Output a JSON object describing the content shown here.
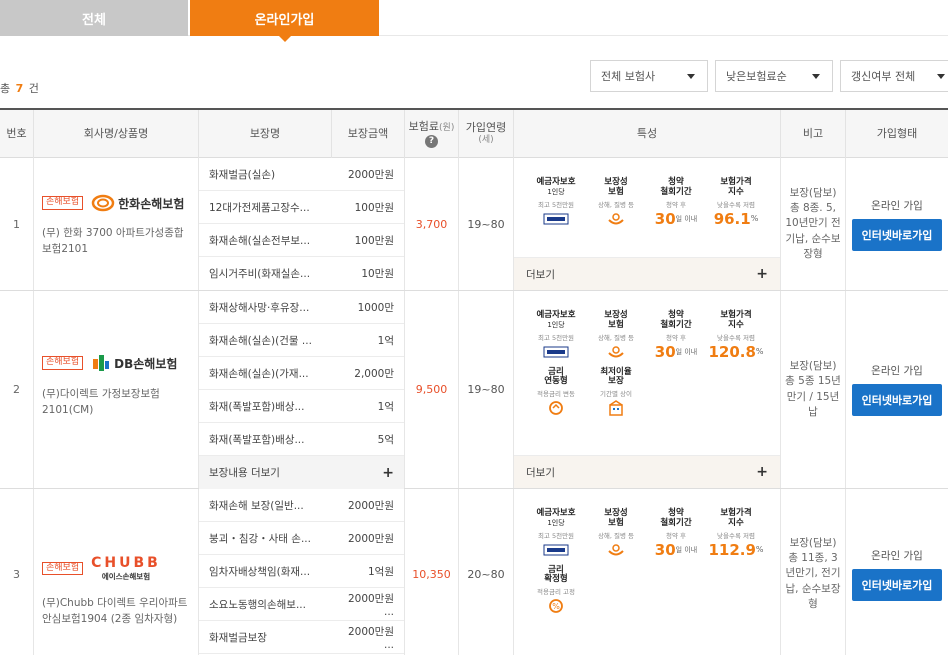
{
  "tabs": {
    "all": "전체",
    "online": "온라인가입"
  },
  "count": {
    "prefix": "총",
    "num": "7",
    "suffix": "건"
  },
  "filters": {
    "insurer": "전체 보험사",
    "sort": "낮은보험료순",
    "renew": "갱신여부 전체"
  },
  "header": {
    "no": "번호",
    "company": "회사명/상품명",
    "coverage": "보장명",
    "amount": "보장금액",
    "premium": "보험료",
    "premium_unit": "(원)",
    "age": "가입연령",
    "age_unit": "(세)",
    "features": "특성",
    "note": "비고",
    "type": "가입형태",
    "help": "?"
  },
  "feature_labels": {
    "deposit_t1": "예금자보호",
    "deposit_t2": "1인당",
    "deposit_s": "최고 5천만원",
    "guarantee_t1": "보장성",
    "guarantee_t2": "보험",
    "guarantee_s": "상해, 질병 등",
    "withdraw_t1": "청약",
    "withdraw_t2": "철회기간",
    "withdraw_s": "청약 후",
    "withdraw_days": "30",
    "withdraw_unit": "일 이내",
    "price_t1": "보험가격",
    "price_t2": "지수",
    "price_s": "낮을수록 저렴",
    "pct": "%",
    "rate_var_t1": "금리",
    "rate_var_t2": "연동형",
    "rate_var_s": "적용금리 변동",
    "min_rate_t1": "최저이율",
    "min_rate_t2": "보장",
    "min_rate_s": "기간별 상이",
    "rate_fix_t1": "금리",
    "rate_fix_t2": "확정형",
    "rate_fix_s": "적용금리 고정",
    "more": "더보기"
  },
  "colors": {
    "accent": "#f07d12",
    "premium": "#e8502a",
    "button": "#1a73c8"
  },
  "products": [
    {
      "no": "1",
      "badge": "손해보험",
      "logo": "한화손해보험",
      "name": "(무) 한화 3700 아파트가성종합보험2101",
      "coverages": [
        {
          "name": "화재벌금(실손)",
          "amount": "2000만원"
        },
        {
          "name": "12대가전제품고장수...",
          "amount": "100만원"
        },
        {
          "name": "화재손해(실손전부보...",
          "amount": "100만원"
        },
        {
          "name": "임시거주비(화재실손...",
          "amount": "10만원"
        }
      ],
      "premium": "3,700",
      "age": "19~80",
      "price_index": "96.1",
      "note": "보장(담보) 총 8종. 5, 10년만기 전기납, 순수보장형",
      "type": "온라인 가입",
      "button": "인터넷바로가입"
    },
    {
      "no": "2",
      "badge": "손해보험",
      "logo": "DB손해보험",
      "name": "(무)다이렉트 가정보장보험2101(CM)",
      "coverages": [
        {
          "name": "화재상해사망·후유장...",
          "amount": "1000만"
        },
        {
          "name": "화재손해(실손)(건물 ...",
          "amount": "1억"
        },
        {
          "name": "화재손해(실손)(가재...",
          "amount": "2,000만"
        },
        {
          "name": "화재(폭발포함)배상...",
          "amount": "1억"
        },
        {
          "name": "화재(폭발포함)배상...",
          "amount": "5억"
        }
      ],
      "more_coverage": "보장내용 더보기",
      "premium": "9,500",
      "age": "19~80",
      "price_index": "120.8",
      "note": "보장(담보) 총 5종 15년만기 / 15년납",
      "type": "온라인 가입",
      "button": "인터넷바로가입"
    },
    {
      "no": "3",
      "badge": "손해보험",
      "logo": "CHUBB",
      "logo_sub": "에이스손해보험",
      "name": "(무)Chubb 다이렉트 우리아파트안심보험1904 (2종 임차자형)",
      "coverages": [
        {
          "name": "화재손해 보장(일반...",
          "amount": "2000만원"
        },
        {
          "name": "붕괴・침강・사태 손...",
          "amount": "2000만원"
        },
        {
          "name": "임차자배상책임(화재...",
          "amount": "1억원"
        },
        {
          "name": "소요노동행의손해보...",
          "amount": "2000만원 ..."
        },
        {
          "name": "화재벌금보장",
          "amount": "2000만원 ..."
        }
      ],
      "premium": "10,350",
      "age": "20~80",
      "price_index": "112.9",
      "note": "보장(담보) 총 11종, 3년만기, 전기납, 순수보장형",
      "type": "온라인 가입",
      "button": "인터넷바로가입"
    }
  ]
}
